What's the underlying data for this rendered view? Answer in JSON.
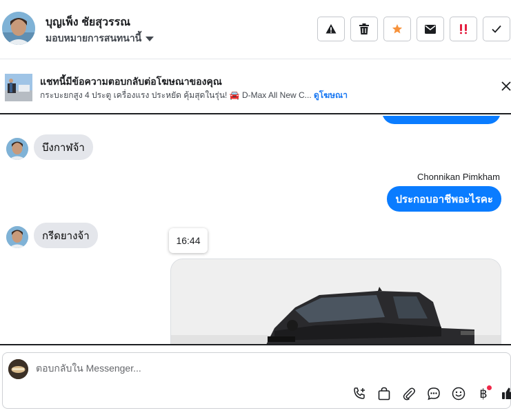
{
  "header": {
    "contact_name": "บุญเพ็ง ชัยสุวรรณ",
    "assign_label": "มอบหมายการสนทนานี้",
    "actions": [
      {
        "icon": "warning-icon"
      },
      {
        "icon": "trash-icon"
      },
      {
        "icon": "star-icon",
        "color": "#f7923b"
      },
      {
        "icon": "mail-icon"
      },
      {
        "icon": "urgent-icon",
        "color": "#e41e3f"
      },
      {
        "icon": "check-icon"
      }
    ]
  },
  "banner": {
    "title": "แชทนี้มีข้อความตอบกลับต่อโฆษณาของคุณ",
    "ad_text": "กระบะยกสูง 4 ประตู เครื่องแรง ประหยัด คุ้มสุดในรุ่น! 🚘 D-Max All New C...",
    "see_ad_label": "ดูโฆษณา"
  },
  "messages": [
    {
      "direction": "in",
      "text": "บึงกาฬจ้า"
    },
    {
      "direction": "out",
      "sender": "Chonnikan Pimkham",
      "text": "ประกอบอาชีพอะไรคะ"
    },
    {
      "direction": "in",
      "text": "กรีดยางจ้า"
    }
  ],
  "timestamp_tooltip": "16:44",
  "composer": {
    "placeholder": "ตอบกลับใน Messenger...",
    "baht_symbol": "฿"
  },
  "colors": {
    "outgoing_bubble": "#0a7cff",
    "incoming_bubble": "#e4e6eb",
    "link": "#1877f2"
  }
}
